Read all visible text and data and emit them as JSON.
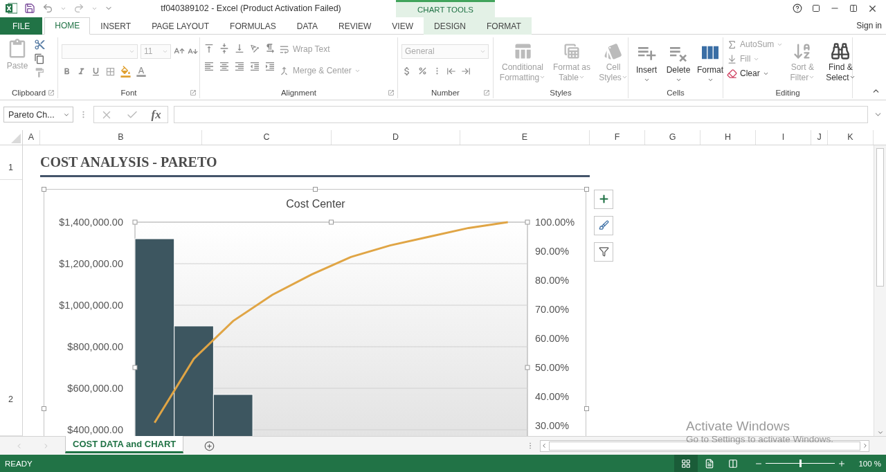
{
  "window": {
    "title": "tf040389102 - Excel (Product Activation Failed)",
    "context_group": "CHART TOOLS",
    "sign_in": "Sign in"
  },
  "ribbon_tabs": [
    {
      "label": "FILE",
      "kind": "file",
      "selected": false
    },
    {
      "label": "HOME",
      "kind": "main",
      "selected": true
    },
    {
      "label": "INSERT",
      "kind": "main",
      "selected": false
    },
    {
      "label": "PAGE LAYOUT",
      "kind": "main",
      "selected": false
    },
    {
      "label": "FORMULAS",
      "kind": "main",
      "selected": false
    },
    {
      "label": "DATA",
      "kind": "main",
      "selected": false
    },
    {
      "label": "REVIEW",
      "kind": "main",
      "selected": false
    },
    {
      "label": "VIEW",
      "kind": "main",
      "selected": false
    },
    {
      "label": "DESIGN",
      "kind": "contextual",
      "selected": false
    },
    {
      "label": "FORMAT",
      "kind": "contextual",
      "selected": false
    }
  ],
  "ribbon_groups": [
    {
      "kind": "clipboard",
      "label": "Clipboard",
      "launcher": true,
      "paste": {
        "label": "Paste",
        "disabled": true
      }
    },
    {
      "kind": "font",
      "label": "Font",
      "launcher": true,
      "font_size": "11"
    },
    {
      "kind": "alignment",
      "label": "Alignment",
      "launcher": true,
      "wrap_text": {
        "label": "Wrap Text",
        "disabled": true
      },
      "merge": {
        "label": "Merge & Center",
        "disabled": true
      }
    },
    {
      "kind": "number",
      "label": "Number",
      "launcher": true,
      "format": "General"
    },
    {
      "kind": "styles",
      "label": "Styles",
      "launcher": false,
      "commands": [
        {
          "label": "Conditional Formatting",
          "disabled": true
        },
        {
          "label": "Format as Table",
          "disabled": true
        },
        {
          "label": "Cell Styles",
          "disabled": true
        }
      ]
    },
    {
      "kind": "cells",
      "label": "Cells",
      "launcher": false,
      "commands": [
        {
          "label": "Insert",
          "disabled": false
        },
        {
          "label": "Delete",
          "disabled": false
        },
        {
          "label": "Format",
          "disabled": false
        }
      ]
    },
    {
      "kind": "editing",
      "label": "Editing",
      "launcher": false,
      "small": [
        {
          "label": "AutoSum",
          "disabled": true
        },
        {
          "label": "Fill",
          "disabled": true
        },
        {
          "label": "Clear",
          "disabled": false
        }
      ],
      "commands": [
        {
          "label": "Sort & Filter",
          "disabled": true
        },
        {
          "label": "Find & Select",
          "disabled": false
        }
      ]
    }
  ],
  "formula_bar": {
    "name_box": "Pareto Ch...",
    "function_label": "fx"
  },
  "columns": [
    "A",
    "B",
    "C",
    "D",
    "E",
    "F",
    "G",
    "H",
    "I",
    "J",
    "K"
  ],
  "rows": [
    "1",
    "2"
  ],
  "sheet": {
    "title": "COST ANALYSIS - PARETO",
    "chart": {
      "chart_data": {
        "type": "bar",
        "title": "Cost Center",
        "grid": true,
        "ylim": [
          0,
          1400000
        ],
        "y2lim": [
          0,
          1
        ],
        "yticks": [
          {
            "value": 1400000,
            "label": "$1,400,000.00"
          },
          {
            "value": 1200000,
            "label": "$1,200,000.00"
          },
          {
            "value": 1000000,
            "label": "$1,000,000.00"
          },
          {
            "value": 800000,
            "label": "$800,000.00"
          },
          {
            "value": 600000,
            "label": "$600,000.00"
          },
          {
            "value": 400000,
            "label": "$400,000.00"
          }
        ],
        "y2ticks": [
          {
            "value": 1,
            "label": "100.00%"
          },
          {
            "value": 0.9,
            "label": "90.00%"
          },
          {
            "value": 0.8,
            "label": "80.00%"
          },
          {
            "value": 0.7,
            "label": "70.00%"
          },
          {
            "value": 0.6,
            "label": "60.00%"
          },
          {
            "value": 0.5,
            "label": "50.00%"
          },
          {
            "value": 0.4,
            "label": "40.00%"
          },
          {
            "value": 0.3,
            "label": "30.00%"
          }
        ],
        "series": [
          {
            "type": "bar",
            "color": "#3d5660",
            "values": [
              1320000,
              900000,
              570000,
              null,
              null,
              null,
              null,
              null,
              null,
              null
            ]
          },
          {
            "type": "line",
            "axis": "y2",
            "color": "#e0a545",
            "values": [
              0.31,
              0.53,
              0.66,
              0.75,
              0.82,
              0.88,
              0.92,
              0.95,
              0.98,
              1.0
            ]
          }
        ]
      }
    }
  },
  "sheet_tabs": [
    {
      "label": "COST DATA and CHART",
      "selected": true
    }
  ],
  "status_bar": {
    "mode": "READY",
    "zoom": "100 %",
    "zoom_level": {
      "level": 0.5
    }
  },
  "os_notice": {
    "title": "Activate Windows",
    "message": "Go to Settings to activate Windows."
  }
}
